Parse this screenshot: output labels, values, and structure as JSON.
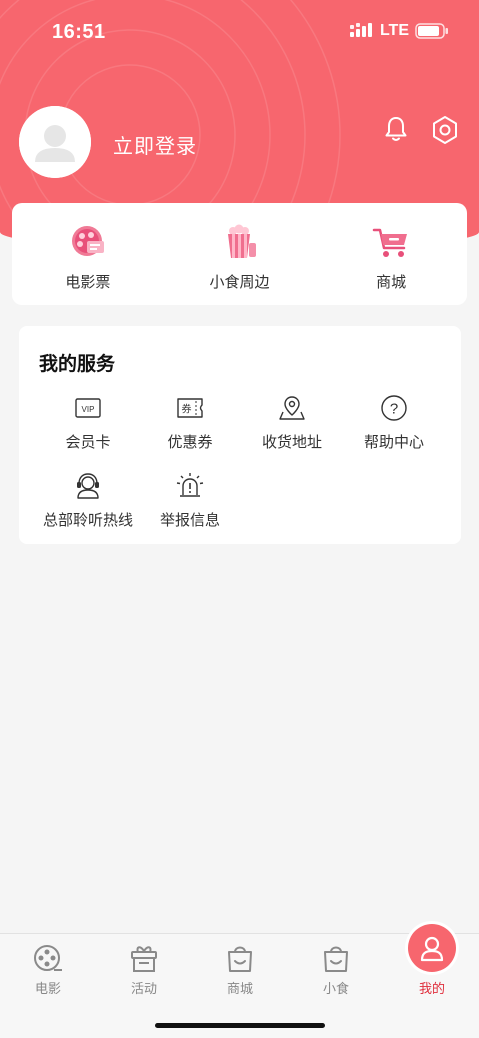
{
  "status_bar": {
    "time": "16:51",
    "network": "LTE"
  },
  "header": {
    "login_text": "立即登录"
  },
  "quick_links": [
    {
      "label": "电影票",
      "icon": "film-ticket-icon"
    },
    {
      "label": "小食周边",
      "icon": "popcorn-icon"
    },
    {
      "label": "商城",
      "icon": "shopping-cart-icon"
    }
  ],
  "services": {
    "title": "我的服务",
    "items": [
      {
        "label": "会员卡",
        "icon": "vip-card-icon",
        "icon_text": "VIP"
      },
      {
        "label": "优惠券",
        "icon": "coupon-icon",
        "icon_text": "券"
      },
      {
        "label": "收货地址",
        "icon": "location-pin-icon"
      },
      {
        "label": "帮助中心",
        "icon": "help-circle-icon",
        "icon_text": "?"
      },
      {
        "label": "总部聆听热线",
        "icon": "headset-icon"
      },
      {
        "label": "举报信息",
        "icon": "alarm-icon"
      }
    ]
  },
  "tabs": [
    {
      "label": "电影",
      "icon": "film-reel-icon",
      "active": false
    },
    {
      "label": "活动",
      "icon": "gift-icon",
      "active": false
    },
    {
      "label": "商城",
      "icon": "shopping-bag-icon",
      "active": false
    },
    {
      "label": "小食",
      "icon": "snack-bag-icon",
      "active": false
    },
    {
      "label": "我的",
      "icon": "user-icon",
      "active": true
    }
  ],
  "colors": {
    "brand": "#f7666e",
    "active_tab": "#e02e3c",
    "background": "#f5f5f5"
  }
}
